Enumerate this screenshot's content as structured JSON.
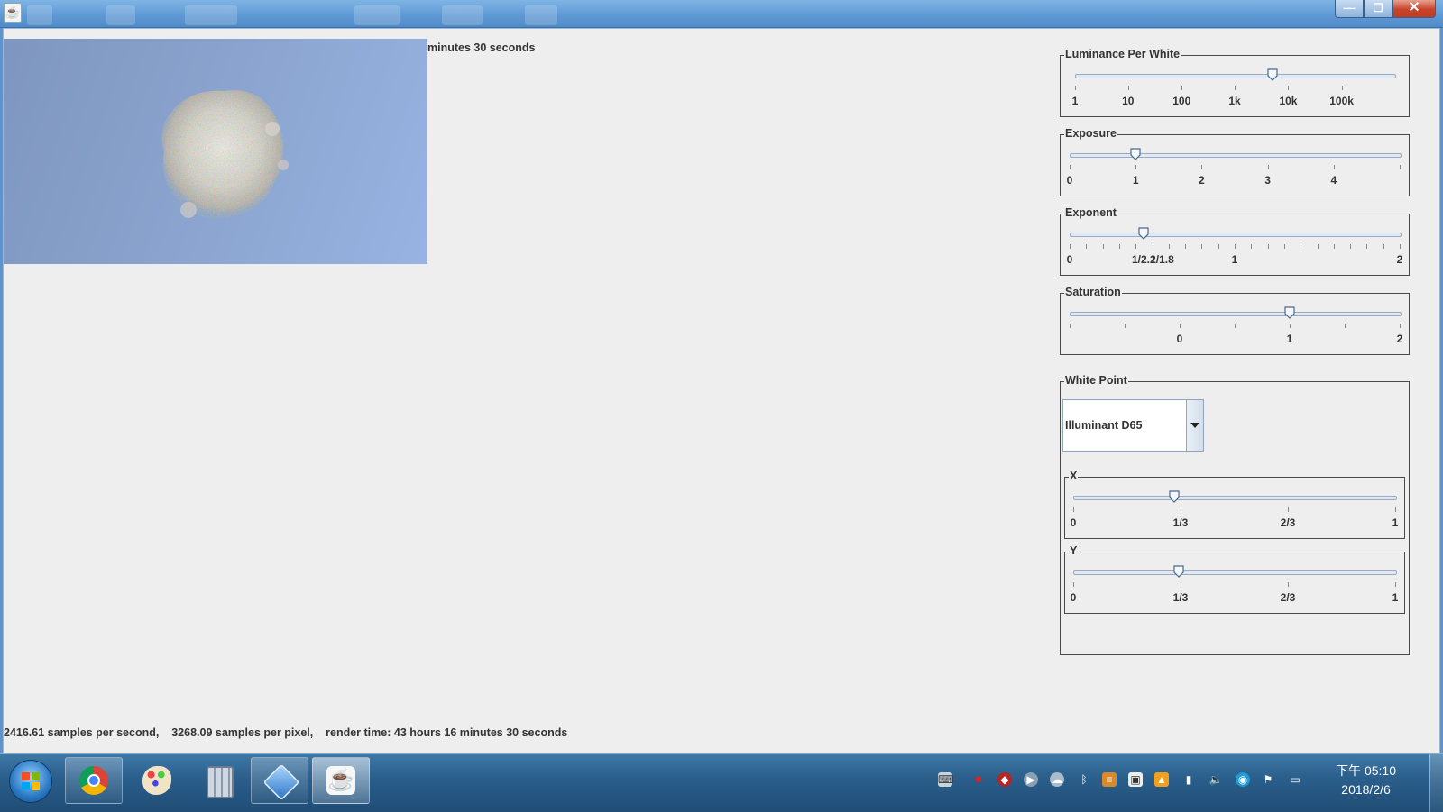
{
  "window": {
    "minimize_icon": "minimize-icon",
    "maximize_icon": "maximize-icon",
    "close_icon": "close-icon",
    "minimize_glyph": "—",
    "maximize_glyph": "☐",
    "close_glyph": "✕"
  },
  "status": {
    "top_visible": "minutes 30 seconds",
    "bottom": "2416.61 samples per second,    3268.09 samples per pixel,    render time: 43 hours 16 minutes 30 seconds"
  },
  "controls": {
    "luminance": {
      "title": "Luminance Per White",
      "value_fraction": 0.62,
      "ticks": [
        "1",
        "10",
        "100",
        "1k",
        "10k",
        "100k"
      ]
    },
    "exposure": {
      "title": "Exposure",
      "value": 1.0,
      "range": [
        0,
        5
      ],
      "ticks": [
        "0",
        "1",
        "2",
        "3",
        "4"
      ]
    },
    "exponent": {
      "title": "Exponent",
      "value": 0.45,
      "range": [
        0,
        2
      ],
      "ticks": [
        "0",
        "1/2.2",
        "1/1.8",
        "1",
        "2"
      ]
    },
    "saturation": {
      "title": "Saturation",
      "value": 1.0,
      "range": [
        -1,
        2
      ],
      "ticks": [
        "0",
        "1",
        "2"
      ]
    },
    "white_point": {
      "title": "White Point",
      "selected": "Illuminant D65",
      "x": {
        "title": "X",
        "value": 0.3127,
        "ticks": [
          "0",
          "1/3",
          "2/3",
          "1"
        ]
      },
      "y": {
        "title": "Y",
        "value": 0.329,
        "ticks": [
          "0",
          "1/3",
          "2/3",
          "1"
        ]
      }
    }
  },
  "taskbar": {
    "apps": [
      "chrome-icon",
      "paint-icon",
      "calculator-icon",
      "virtualbox-icon",
      "java-icon"
    ],
    "clock_time": "下午 05:10",
    "clock_date": "2018/2/6"
  },
  "colors": {
    "titlebar": "#5d98d3",
    "client_bg": "#eeeeee",
    "taskbar": "#2b5f8c",
    "close_button": "#c7442a"
  }
}
